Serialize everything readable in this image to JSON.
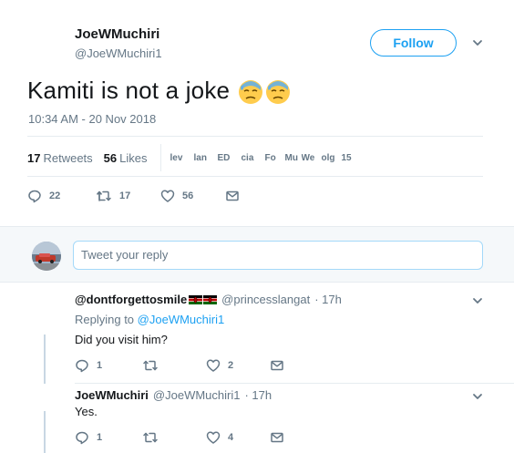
{
  "tweet": {
    "author_name": "JoeWMuchiri",
    "author_handle": "@JoeWMuchiri1",
    "follow_label": "Follow",
    "text": "Kamiti is not a joke",
    "emojis": [
      "downcast-face-with-sweat",
      "downcast-face-with-sweat"
    ],
    "timestamp": "10:34 AM - 20 Nov 2018",
    "retweets_count": "17",
    "retweets_label": "Retweets",
    "likes_count": "56",
    "likes_label": "Likes",
    "liker_avatars": [
      "lev",
      "lan",
      "ED",
      "cia",
      "Fo",
      "Mu",
      "We",
      "olg"
    ],
    "liker_more": "15",
    "actions": {
      "replies": "22",
      "retweets": "17",
      "likes": "56"
    }
  },
  "reply_box": {
    "placeholder": "Tweet your reply"
  },
  "replies": [
    {
      "name": "@dontforgettosmile",
      "handle": "@princesslangat",
      "time": "· 17h",
      "replying_prefix": "Replying to",
      "replying_to": "@JoeWMuchiri1",
      "text": "Did you visit him?",
      "reply_count": "1",
      "retweet_count": "",
      "like_count": "2"
    },
    {
      "name": "JoeWMuchiri",
      "handle": "@JoeWMuchiri1",
      "time": "· 17h",
      "text": "Yes.",
      "reply_count": "1",
      "retweet_count": "",
      "like_count": "4"
    }
  ],
  "colors": {
    "accent": "#1da1f2",
    "muted": "#657786",
    "border": "#e6ecf0",
    "reply_bg": "#f5f8fa"
  }
}
